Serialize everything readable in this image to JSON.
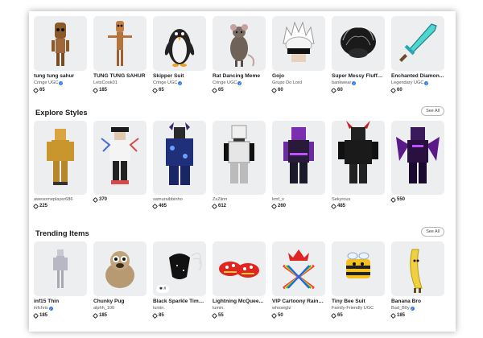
{
  "featured_items": [
    {
      "name": "tung tung sahur",
      "creator": "Cringe UGC",
      "verified": true,
      "price": "65",
      "icon": "wooden-figure-icon"
    },
    {
      "name": "TUNG TUNG SAHUR",
      "creator": "LetsCook01",
      "verified": false,
      "price": "185",
      "icon": "wooden-figure-icon"
    },
    {
      "name": "Skipper Suit",
      "creator": "Cringe UGC",
      "verified": true,
      "price": "65",
      "icon": "penguin-icon"
    },
    {
      "name": "Rat Dancing Meme",
      "creator": "Cringe UGC",
      "verified": true,
      "price": "65",
      "icon": "rat-icon"
    },
    {
      "name": "Gojo",
      "creator": "Grupo Do Lord",
      "verified": false,
      "price": "60",
      "icon": "white-hair-icon"
    },
    {
      "name": "Super Messy Fluffy ...",
      "creator": "bankwear",
      "verified": true,
      "price": "60",
      "icon": "black-hair-icon"
    },
    {
      "name": "Enchanted Diamon...",
      "creator": "Legendary UGC",
      "verified": true,
      "price": "60",
      "icon": "diamond-sword-icon"
    }
  ],
  "explore_styles": {
    "title": "Explore Styles",
    "see_all": "See All",
    "items": [
      {
        "creator": "awesomeplayer686",
        "price": "225"
      },
      {
        "creator": "",
        "price": "370"
      },
      {
        "creator": "samuraibbinho",
        "price": "465"
      },
      {
        "creator": "ZxZiinn",
        "price": "612"
      },
      {
        "creator": "kmf_x",
        "price": "260"
      },
      {
        "creator": "Sekyrous",
        "price": "485"
      },
      {
        "creator": "",
        "price": "550"
      }
    ]
  },
  "trending_items": {
    "title": "Trending Items",
    "see_all": "See All",
    "items": [
      {
        "name": "inf15 Thin",
        "creator": "infchris",
        "verified": true,
        "price": "185"
      },
      {
        "name": "Chunky Pug",
        "creator": "alphh_100",
        "verified": false,
        "price": "185"
      },
      {
        "name": "Black Sparkle Time ...",
        "creator": "lumin.",
        "verified": false,
        "price": "85",
        "badge": "✱ #"
      },
      {
        "name": "Lightning McQuee...",
        "creator": "lumin.",
        "verified": false,
        "price": "55"
      },
      {
        "name": "VIP Cartoony Rainb...",
        "creator": "whoseglz",
        "verified": false,
        "price": "50"
      },
      {
        "name": "Tiny Bee Suit",
        "creator": "Family-Friendly UGC",
        "verified": false,
        "price": "65"
      },
      {
        "name": "Banana Bro",
        "creator": "Bad_B0y",
        "verified": true,
        "price": "185"
      }
    ]
  },
  "colors": {
    "verified": "#2f7ae5",
    "card_bg": "#eceef0",
    "text": "#1c1c1c"
  }
}
